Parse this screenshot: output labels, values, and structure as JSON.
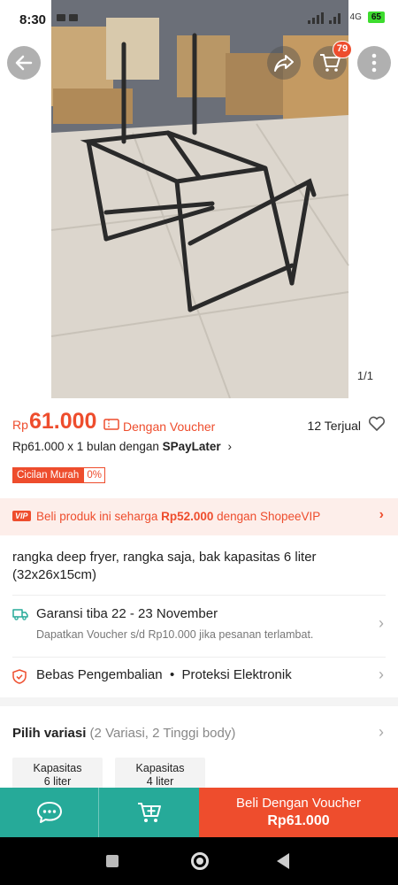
{
  "status_bar": {
    "time": "8:30",
    "network": "4G",
    "battery": "65"
  },
  "header": {
    "back_icon": "arrow-left-icon",
    "share_icon": "share-icon",
    "cart_icon": "cart-icon",
    "cart_count": "79",
    "more_icon": "more-vertical-icon"
  },
  "gallery": {
    "page_indicator": "1/1"
  },
  "price": {
    "currency": "Rp",
    "amount": "61.000",
    "voucher_label": "Dengan Voucher",
    "sold_label": "12 Terjual",
    "spaylater_prefix": "Rp61.000 x 1 bulan dengan ",
    "spaylater_brand": "SPayLater",
    "spaylater_chevron": "›",
    "cicilan_label": "Cicilan Murah",
    "cicilan_rate": "0%"
  },
  "vip": {
    "badge": "VIP",
    "text_prefix": "Beli produk ini seharga ",
    "text_price": "Rp52.000",
    "text_suffix": " dengan ShopeeVIP",
    "chevron": "›"
  },
  "product": {
    "title": "rangka deep fryer, rangka saja, bak kapasitas 6 liter (32x26x15cm)"
  },
  "shipping": {
    "title": "Garansi tiba 22 - 23 November",
    "subtitle": "Dapatkan Voucher s/d Rp10.000 jika pesanan terlambat.",
    "chevron": "›"
  },
  "returns": {
    "text": "Bebas Pengembalian  •  Proteksi Elektronik",
    "chevron": "›"
  },
  "variasi": {
    "label": "Pilih variasi",
    "detail": " (2 Variasi, 2 Tinggi body)",
    "chevron": "›",
    "options": [
      {
        "line1": "Kapasitas",
        "line2": "6 liter"
      },
      {
        "line1": "Kapasitas",
        "line2": "4 liter"
      }
    ]
  },
  "actions": {
    "chat_icon": "chat-icon",
    "add_cart_icon": "add-to-cart-icon",
    "buy_label": "Beli Dengan Voucher",
    "buy_price": "Rp61.000"
  },
  "colors": {
    "brand": "#ee4d2d",
    "teal": "#26aa99"
  }
}
